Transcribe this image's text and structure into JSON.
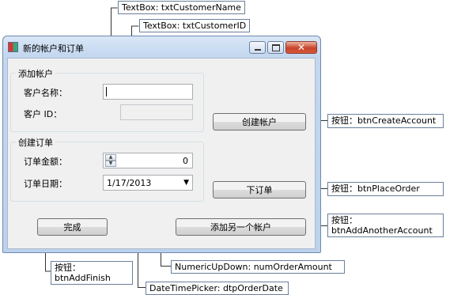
{
  "window": {
    "title": "新的帐户和订单"
  },
  "account_group": {
    "title": "添加帐户",
    "customer_name_label": "客户名称：",
    "customer_id_label": "客户 ID：",
    "customer_name_value": "",
    "customer_id_value": ""
  },
  "order_group": {
    "title": "创建订单",
    "amount_label": "订单金额：",
    "date_label": "订单日期：",
    "amount_value": "0",
    "date_value": "1/17/2013"
  },
  "buttons": {
    "create_account": "创建帐户",
    "place_order": "下订单",
    "add_another": "添加另一个帐户",
    "finish": "完成"
  },
  "callouts": {
    "customer_name": "TextBox: txtCustomerName",
    "customer_id": "TextBox: txtCustomerID",
    "create_account": "按钮：btnCreateAccount",
    "place_order": "按钮：btnPlaceOrder",
    "add_another_line1": "按钮：",
    "add_another_line2": "btnAddAnotherAccount",
    "finish_line1": "按钮：",
    "finish_line2": "btnAddFinish",
    "numeric": "NumericUpDown: numOrderAmount",
    "datepicker": "DateTimePicker: dtpOrderDate"
  },
  "colors": {
    "callout_border": "#6b7f9c",
    "close_button": "#c8452b",
    "title_bar": "#c3d7ef"
  }
}
